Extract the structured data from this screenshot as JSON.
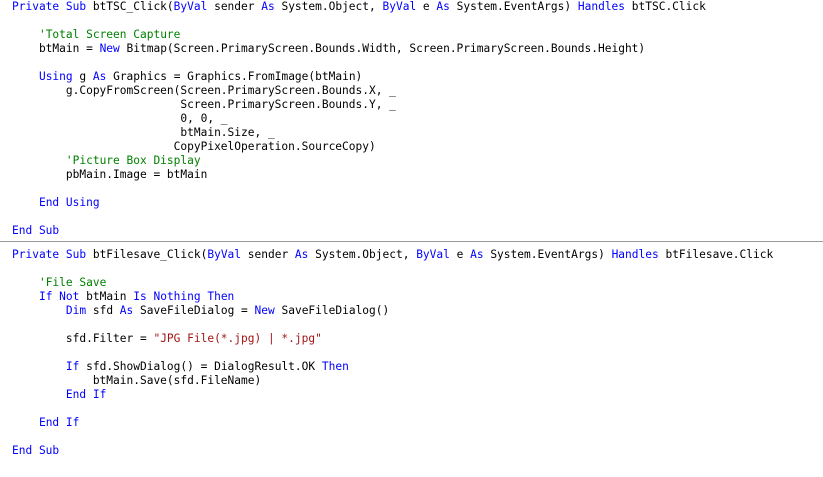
{
  "colors": {
    "keyword": "#0000ff",
    "comment": "#008000",
    "string": "#a31515",
    "text": "#000000",
    "background": "#ffffff",
    "separator": "#9a9a9a"
  },
  "blocks": [
    {
      "lines": [
        [
          [
            "kw",
            "Private Sub "
          ],
          [
            "tx",
            "btTSC_Click("
          ],
          [
            "kw",
            "ByVal"
          ],
          [
            "tx",
            " sender "
          ],
          [
            "kw",
            "As"
          ],
          [
            "tx",
            " System.Object, "
          ],
          [
            "kw",
            "ByVal"
          ],
          [
            "tx",
            " e "
          ],
          [
            "kw",
            "As"
          ],
          [
            "tx",
            " System.EventArgs) "
          ],
          [
            "kw",
            "Handles"
          ],
          [
            "tx",
            " btTSC.Click"
          ]
        ],
        [],
        [
          [
            "tx",
            "    "
          ],
          [
            "cm",
            "'Total Screen Capture"
          ]
        ],
        [
          [
            "tx",
            "    btMain = "
          ],
          [
            "kw",
            "New"
          ],
          [
            "tx",
            " Bitmap(Screen.PrimaryScreen.Bounds.Width, Screen.PrimaryScreen.Bounds.Height)"
          ]
        ],
        [],
        [
          [
            "tx",
            "    "
          ],
          [
            "kw",
            "Using"
          ],
          [
            "tx",
            " g "
          ],
          [
            "kw",
            "As"
          ],
          [
            "tx",
            " Graphics = Graphics.FromImage(btMain)"
          ]
        ],
        [
          [
            "tx",
            "        g.CopyFromScreen(Screen.PrimaryScreen.Bounds.X, _"
          ]
        ],
        [
          [
            "tx",
            "                         Screen.PrimaryScreen.Bounds.Y, _"
          ]
        ],
        [
          [
            "tx",
            "                         0, 0, _"
          ]
        ],
        [
          [
            "tx",
            "                         btMain.Size, _"
          ]
        ],
        [
          [
            "tx",
            "                        CopyPixelOperation.SourceCopy)"
          ]
        ],
        [
          [
            "tx",
            "        "
          ],
          [
            "cm",
            "'Picture Box Display"
          ]
        ],
        [
          [
            "tx",
            "        pbMain.Image = btMain"
          ]
        ],
        [],
        [
          [
            "tx",
            "    "
          ],
          [
            "kw",
            "End Using"
          ]
        ],
        [],
        [
          [
            "kw",
            "End Sub"
          ]
        ]
      ]
    },
    {
      "lines": [
        [
          [
            "kw",
            "Private Sub "
          ],
          [
            "tx",
            "btFilesave_Click("
          ],
          [
            "kw",
            "ByVal"
          ],
          [
            "tx",
            " sender "
          ],
          [
            "kw",
            "As"
          ],
          [
            "tx",
            " System.Object, "
          ],
          [
            "kw",
            "ByVal"
          ],
          [
            "tx",
            " e "
          ],
          [
            "kw",
            "As"
          ],
          [
            "tx",
            " System.EventArgs) "
          ],
          [
            "kw",
            "Handles"
          ],
          [
            "tx",
            " btFilesave.Click"
          ]
        ],
        [],
        [
          [
            "tx",
            "    "
          ],
          [
            "cm",
            "'File Save"
          ]
        ],
        [
          [
            "tx",
            "    "
          ],
          [
            "kw",
            "If Not"
          ],
          [
            "tx",
            " btMain "
          ],
          [
            "kw",
            "Is Nothing Then"
          ]
        ],
        [
          [
            "tx",
            "        "
          ],
          [
            "kw",
            "Dim"
          ],
          [
            "tx",
            " sfd "
          ],
          [
            "kw",
            "As"
          ],
          [
            "tx",
            " SaveFileDialog = "
          ],
          [
            "kw",
            "New"
          ],
          [
            "tx",
            " SaveFileDialog()"
          ]
        ],
        [],
        [
          [
            "tx",
            "        sfd.Filter = "
          ],
          [
            "st",
            "\"JPG File(*.jpg) | *.jpg\""
          ]
        ],
        [],
        [
          [
            "tx",
            "        "
          ],
          [
            "kw",
            "If"
          ],
          [
            "tx",
            " sfd.ShowDialog() = DialogResult.OK "
          ],
          [
            "kw",
            "Then"
          ]
        ],
        [
          [
            "tx",
            "            btMain.Save(sfd.FileName)"
          ]
        ],
        [
          [
            "tx",
            "        "
          ],
          [
            "kw",
            "End If"
          ]
        ],
        [],
        [
          [
            "tx",
            "    "
          ],
          [
            "kw",
            "End If"
          ]
        ],
        [],
        [
          [
            "kw",
            "End Sub"
          ]
        ]
      ]
    }
  ]
}
